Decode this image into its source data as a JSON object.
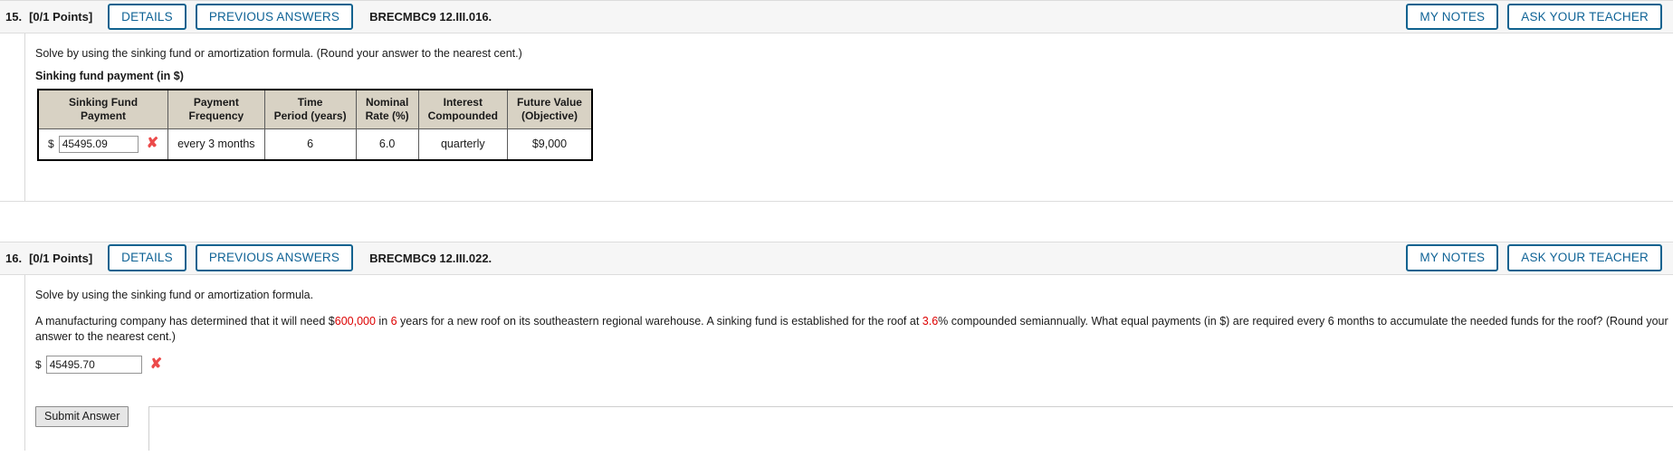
{
  "questions": [
    {
      "number": "15.",
      "points": "[0/1 Points]",
      "details_label": "DETAILS",
      "previous_answers_label": "PREVIOUS ANSWERS",
      "code": "BRECMBC9 12.III.016.",
      "my_notes_label": "MY NOTES",
      "ask_teacher_label": "ASK YOUR TEACHER",
      "prompt": "Solve by using the sinking fund or amortization formula. (Round your answer to the nearest cent.)",
      "sub_label": "Sinking fund payment (in $)",
      "table": {
        "headers": [
          "Sinking Fund\nPayment",
          "Payment\nFrequency",
          "Time\nPeriod (years)",
          "Nominal\nRate (%)",
          "Interest\nCompounded",
          "Future Value\n(Objective)"
        ],
        "headers_lines": [
          [
            "Sinking Fund",
            "Payment"
          ],
          [
            "Payment",
            "Frequency"
          ],
          [
            "Time",
            "Period (years)"
          ],
          [
            "Nominal",
            "Rate (%)"
          ],
          [
            "Interest",
            "Compounded"
          ],
          [
            "Future Value",
            "(Objective)"
          ]
        ],
        "row": {
          "dollar_sign": "$",
          "answer_value": "45495.09",
          "mark": "✘",
          "payment_frequency": "every 3 months",
          "time_period": "6",
          "nominal_rate": "6.0",
          "interest_compounded": "quarterly",
          "future_value": "$9,000"
        }
      }
    },
    {
      "number": "16.",
      "points": "[0/1 Points]",
      "details_label": "DETAILS",
      "previous_answers_label": "PREVIOUS ANSWERS",
      "code": "BRECMBC9 12.III.022.",
      "my_notes_label": "MY NOTES",
      "ask_teacher_label": "ASK YOUR TEACHER",
      "prompt": "Solve by using the sinking fund or amortization formula.",
      "body": {
        "p1": "A manufacturing company has determined that it will need $",
        "v1": "600,000",
        "p2": " in ",
        "v2": "6",
        "p3": " years for a new roof on its southeastern regional warehouse. A sinking fund is established for the roof at ",
        "v3": "3.6",
        "p4": "% compounded semiannually. What equal payments (in $) are required every 6 months to accumulate the needed funds for the roof? (Round your answer to the nearest cent.)"
      },
      "answer": {
        "dollar_sign": "$",
        "value": "45495.70",
        "mark": "✘"
      }
    }
  ],
  "submit": {
    "label": "Submit Answer"
  },
  "colors": {
    "accent_blue": "#0f6396",
    "error_red": "#dd0000",
    "mark_red": "#ec4a4a",
    "table_header_bg": "#d8d2c4",
    "header_bar_bg": "#f6f6f6"
  }
}
